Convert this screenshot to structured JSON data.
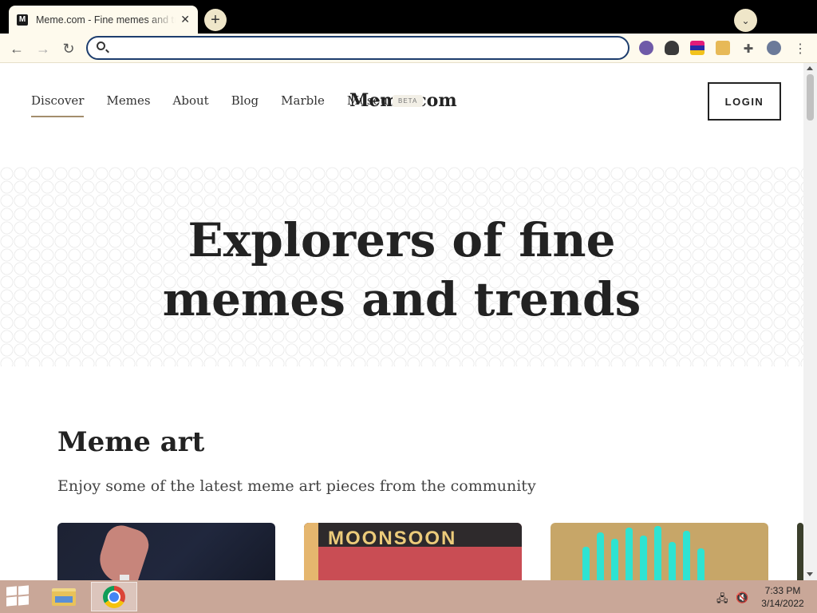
{
  "browser": {
    "tab_title": "Meme.com - Fine memes and trends",
    "tab_favicon": "M",
    "address_value": "",
    "address_placeholder": ""
  },
  "site": {
    "nav": [
      "Discover",
      "Memes",
      "About",
      "Blog",
      "Marble",
      "Museum"
    ],
    "active_nav": "Discover",
    "logo": "Meme.com",
    "beta_badge": "BETA",
    "login_label": "LOGIN"
  },
  "hero": {
    "line1": "Explorers of fine",
    "line2": "memes and trends"
  },
  "section": {
    "title": "Meme art",
    "subtitle": "Enjoy some of the latest meme art pieces from the community",
    "card2_text": "MOONSOON"
  },
  "taskbar": {
    "time": "7:33 PM",
    "date": "3/14/2022"
  }
}
